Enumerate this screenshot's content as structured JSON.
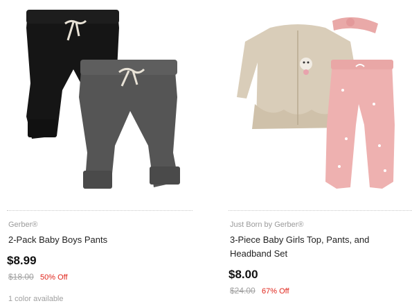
{
  "products": [
    {
      "brand": "Gerber®",
      "title": "2-Pack Baby Boys Pants",
      "price": "$8.99",
      "was_price": "$18.00",
      "discount": "50% Off",
      "color_note": "1 color available",
      "image_icon": "baby-pants-2-pack-image"
    },
    {
      "brand": "Just Born by Gerber®",
      "title": "3-Piece Baby Girls Top, Pants, and Headband Set",
      "price": "$8.00",
      "was_price": "$24.00",
      "discount": "67% Off",
      "image_icon": "baby-girls-3-piece-set-image"
    }
  ],
  "colors": {
    "sale_red": "#e0261c",
    "strike_grey": "#a0a0a0"
  }
}
